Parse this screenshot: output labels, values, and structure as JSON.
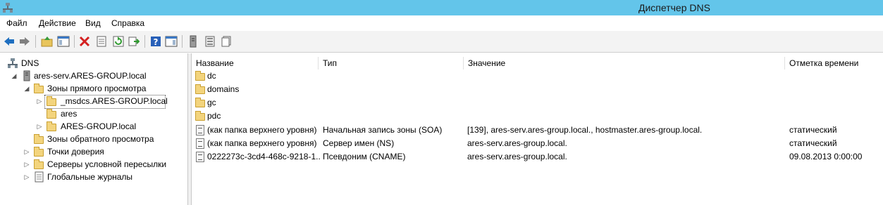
{
  "window": {
    "title": "Диспетчер DNS"
  },
  "menu": [
    "Файл",
    "Действие",
    "Вид",
    "Справка"
  ],
  "toolbar_icons": [
    "back-arrow-icon",
    "forward-arrow-icon",
    "up-folder-icon",
    "show-hide-console-tree-icon",
    "delete-icon",
    "properties-icon",
    "refresh-icon",
    "export-list-icon",
    "help-icon",
    "show-action-pane-icon",
    "server-icon",
    "zone-list-icon",
    "records-icon"
  ],
  "tree": {
    "root": "DNS",
    "server": "ares-serv.ARES-GROUP.local",
    "forward_zones": "Зоны прямого просмотра",
    "zone_msdcs": "_msdcs.ARES-GROUP.local",
    "zone_ares": "ares",
    "zone_ares_group": "ARES-GROUP.local",
    "reverse_zones": "Зоны обратного просмотра",
    "trust_points": "Точки доверия",
    "conditional_forwarders": "Серверы условной пересылки",
    "global_logs": "Глобальные журналы"
  },
  "list": {
    "columns": [
      "Название",
      "Тип",
      "Значение",
      "Отметка времени"
    ],
    "rows": [
      {
        "icon": "folder-icon",
        "name": "dc",
        "type": "",
        "value": "",
        "timestamp": ""
      },
      {
        "icon": "folder-icon",
        "name": "domains",
        "type": "",
        "value": "",
        "timestamp": ""
      },
      {
        "icon": "folder-icon",
        "name": "gc",
        "type": "",
        "value": "",
        "timestamp": ""
      },
      {
        "icon": "folder-icon",
        "name": "pdc",
        "type": "",
        "value": "",
        "timestamp": ""
      },
      {
        "icon": "record-icon",
        "name": "(как папка верхнего уровня)",
        "type": "Начальная запись зоны (SOA)",
        "value": "[139], ares-serv.ares-group.local., hostmaster.ares-group.local.",
        "timestamp": "статический"
      },
      {
        "icon": "record-icon",
        "name": "(как папка верхнего уровня)",
        "type": "Сервер имен (NS)",
        "value": "ares-serv.ares-group.local.",
        "timestamp": "статический"
      },
      {
        "icon": "record-icon",
        "name": "0222273c-3cd4-468c-9218-1...",
        "type": "Псевдоним (CNAME)",
        "value": "ares-serv.ares-group.local.",
        "timestamp": "09.08.2013 0:00:00"
      }
    ]
  }
}
